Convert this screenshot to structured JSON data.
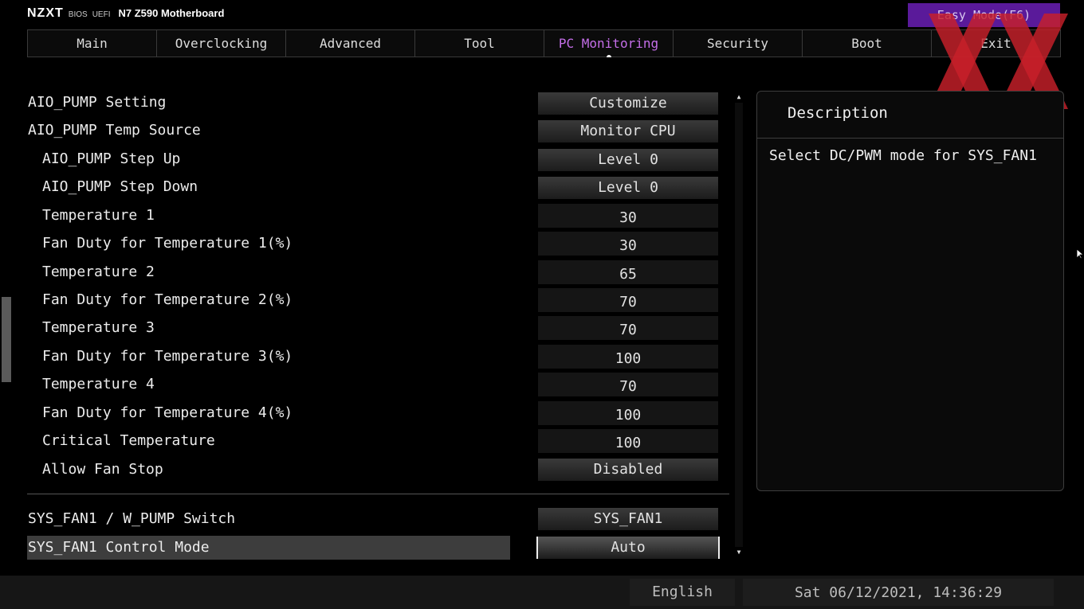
{
  "header": {
    "brand": "NZXT",
    "bios_label": "BIOS",
    "uefi_label": "UEFI",
    "model": "N7 Z590 Motherboard",
    "easy_mode": "Easy Mode(F6)"
  },
  "tabs": [
    {
      "label": "Main",
      "active": false
    },
    {
      "label": "Overclocking",
      "active": false
    },
    {
      "label": "Advanced",
      "active": false
    },
    {
      "label": "Tool",
      "active": false
    },
    {
      "label": "PC Monitoring",
      "active": true
    },
    {
      "label": "Security",
      "active": false
    },
    {
      "label": "Boot",
      "active": false
    },
    {
      "label": "Exit",
      "active": false
    }
  ],
  "settings": [
    {
      "label": "AIO_PUMP Setting",
      "value": "Customize"
    },
    {
      "label": "AIO_PUMP Temp Source",
      "value": "Monitor CPU"
    },
    {
      "label": "AIO_PUMP Step Up",
      "value": "Level 0"
    },
    {
      "label": "AIO_PUMP Step Down",
      "value": "Level 0"
    },
    {
      "label": "Temperature 1",
      "value": "30"
    },
    {
      "label": "Fan Duty for Temperature 1(%)",
      "value": "30"
    },
    {
      "label": "Temperature 2",
      "value": "65"
    },
    {
      "label": "Fan Duty for Temperature 2(%)",
      "value": "70"
    },
    {
      "label": "Temperature 3",
      "value": "70"
    },
    {
      "label": "Fan Duty for Temperature 3(%)",
      "value": "100"
    },
    {
      "label": "Temperature 4",
      "value": "70"
    },
    {
      "label": "Fan Duty for Temperature 4(%)",
      "value": "100"
    },
    {
      "label": "Critical Temperature",
      "value": "100"
    },
    {
      "label": "Allow Fan Stop",
      "value": "Disabled"
    },
    {
      "label": "SYS_FAN1 / W_PUMP Switch",
      "value": "SYS_FAN1"
    },
    {
      "label": "SYS_FAN1 Control Mode",
      "value": "Auto"
    }
  ],
  "description": {
    "title": "Description",
    "text": "Select DC/PWM mode for SYS_FAN1"
  },
  "status": {
    "language": "English",
    "datetime": "Sat 06/12/2021, 14:36:29"
  },
  "colors": {
    "accent": "#c46ee8",
    "easy_mode_bg": "#5a1a9a",
    "watermark": "#c8202a"
  }
}
